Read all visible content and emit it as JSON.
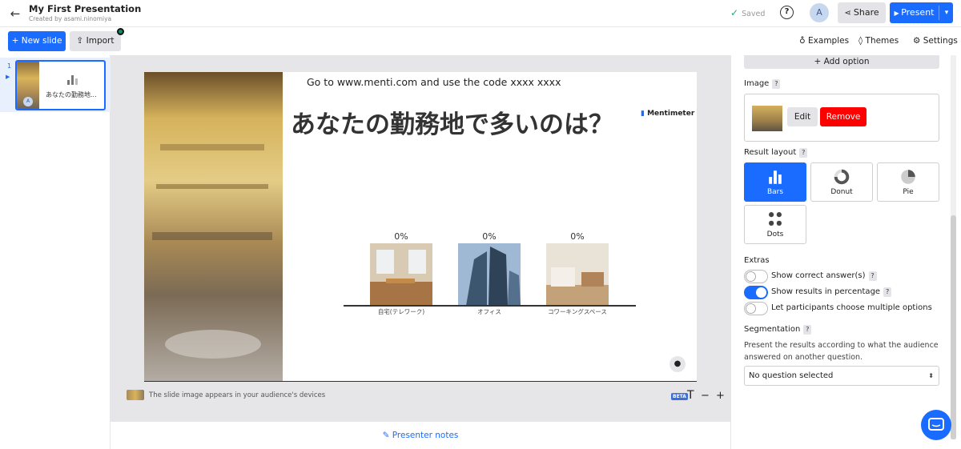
{
  "header": {
    "title": "My First Presentation",
    "subtitle": "Created by asami.ninomiya",
    "saved_label": "Saved",
    "avatar_initial": "A",
    "share_label": "Share",
    "present_label": "Present"
  },
  "toolbar": {
    "new_slide_label": "New slide",
    "import_label": "Import",
    "examples_label": "Examples",
    "themes_label": "Themes",
    "settings_label": "Settings"
  },
  "slides_panel": {
    "items": [
      {
        "number": "1",
        "label": "あなたの勤務地...",
        "avatar": "A"
      }
    ]
  },
  "slide": {
    "instructions": "Go to www.menti.com and use the code xxxx xxxx",
    "brand": "Mentimeter",
    "question": "あなたの勤務地で多いのは？",
    "options": [
      {
        "label": "自宅(テレワーク)",
        "percent": "0%"
      },
      {
        "label": "オフィス",
        "percent": "0%"
      },
      {
        "label": "コワーキングスペース",
        "percent": "0%"
      }
    ]
  },
  "canvas_footer": {
    "image_note": "The slide image appears in your audience's devices",
    "beta_label": "BETA",
    "minus_plus": "− +"
  },
  "presenter_notes_label": "Presenter notes",
  "settings_panel": {
    "add_option_label": "+ Add option",
    "image_label": "Image",
    "edit_label": "Edit",
    "remove_label": "Remove",
    "result_layout_label": "Result layout",
    "layouts": [
      {
        "label": "Bars",
        "selected": true
      },
      {
        "label": "Donut",
        "selected": false
      },
      {
        "label": "Pie",
        "selected": false
      },
      {
        "label": "Dots",
        "selected": false
      }
    ],
    "extras_label": "Extras",
    "extras": [
      {
        "label": "Show correct answer(s)",
        "on": false,
        "has_help": true
      },
      {
        "label": "Show results in percentage",
        "on": true,
        "has_help": true
      },
      {
        "label": "Let participants choose multiple options",
        "on": false,
        "has_help": false
      }
    ],
    "segmentation_label": "Segmentation",
    "segmentation_desc": "Present the results according to what the audience answered on another question.",
    "segmentation_select": "No question selected",
    "help_mark": "?"
  },
  "colors": {
    "accent": "#196cff",
    "remove": "#ff0000",
    "canvas_bg": "#e6e6e8"
  }
}
